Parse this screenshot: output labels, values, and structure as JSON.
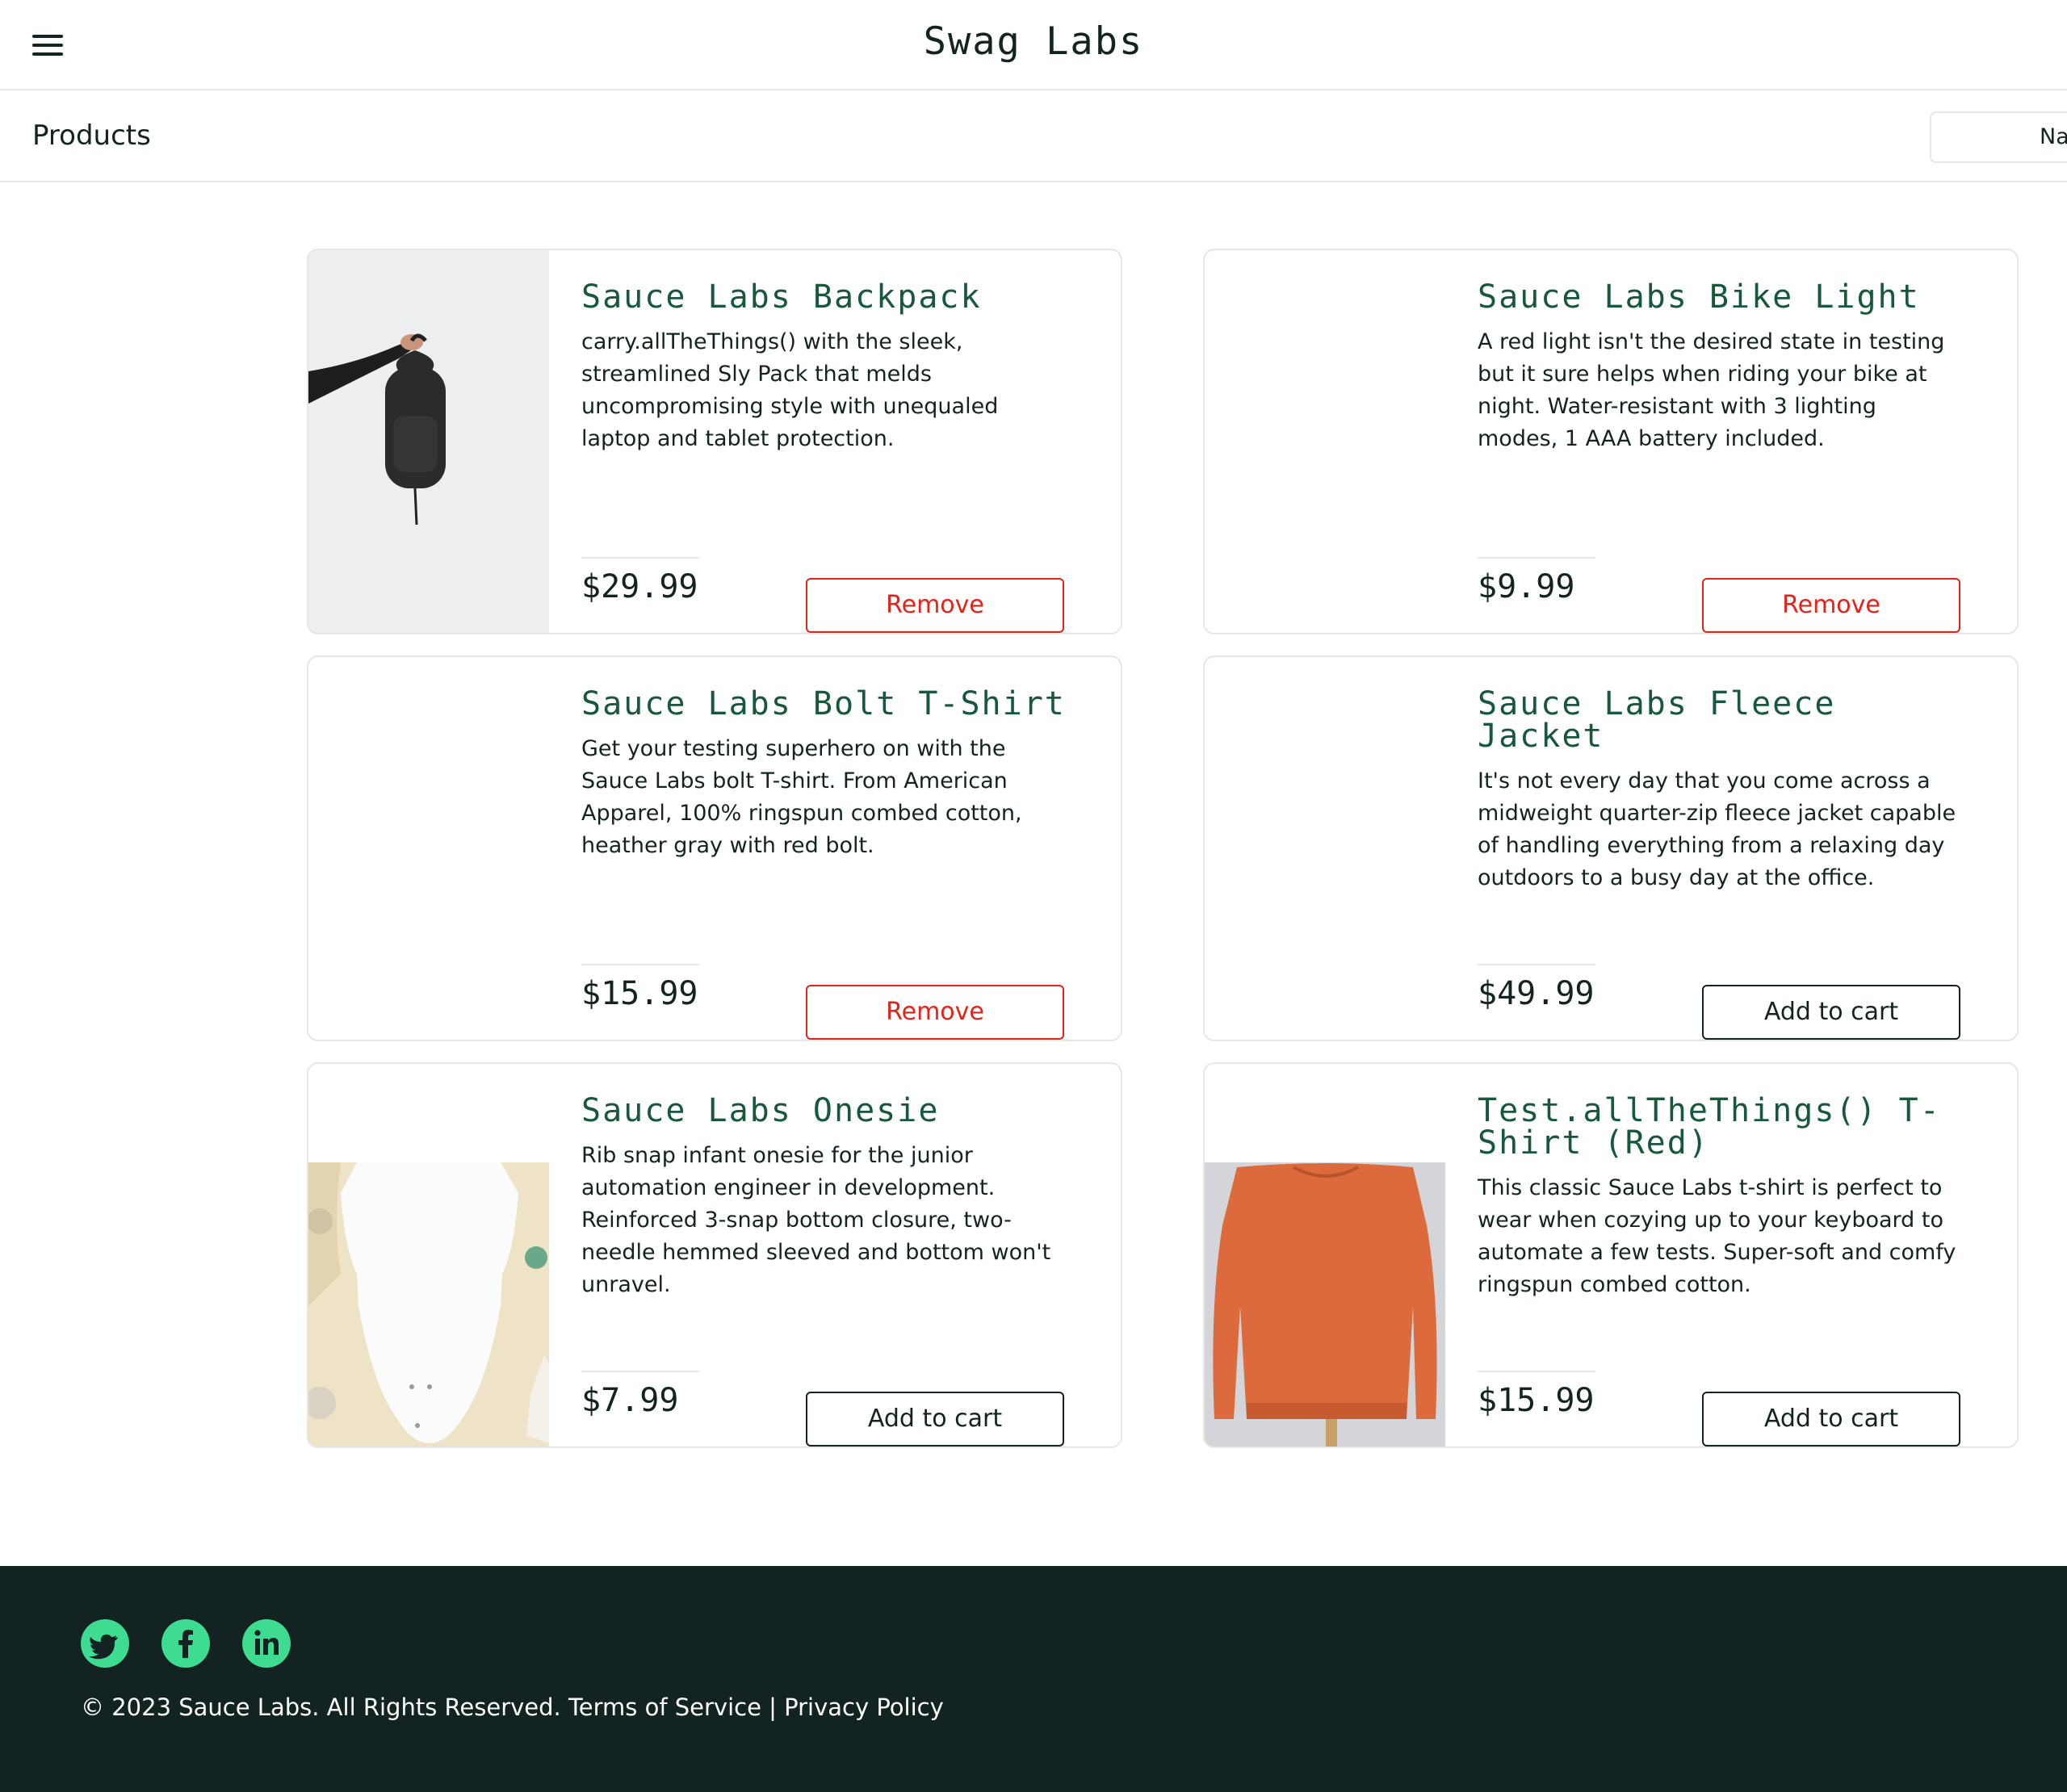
{
  "header": {
    "title": "Swag Labs",
    "menu_icon": "hamburger-menu-icon"
  },
  "subheader": {
    "page_title": "Products",
    "sort_value": "Name (A to Z)"
  },
  "products": [
    {
      "name": "Sauce Labs Backpack",
      "description": "carry.allTheThings() with the sleek, streamlined Sly Pack that melds uncompromising style with unequaled laptop and tablet protection.",
      "price": "$29.99",
      "button": "Remove"
    },
    {
      "name": "Sauce Labs Bike Light",
      "description": "A red light isn't the desired state in testing but it sure helps when riding your bike at night. Water-resistant with 3 lighting modes, 1 AAA battery included.",
      "price": "$9.99",
      "button": "Remove"
    },
    {
      "name": "Sauce Labs Bolt T-Shirt",
      "description": "Get your testing superhero on with the Sauce Labs bolt T-shirt. From American Apparel, 100% ringspun combed cotton, heather gray with red bolt.",
      "price": "$15.99",
      "button": "Remove"
    },
    {
      "name": "Sauce Labs Fleece Jacket",
      "description": "It's not every day that you come across a midweight quarter-zip fleece jacket capable of handling everything from a relaxing day outdoors to a busy day at the office.",
      "price": "$49.99",
      "button": "Add to cart"
    },
    {
      "name": "Sauce Labs Onesie",
      "description": "Rib snap infant onesie for the junior automation engineer in development. Reinforced 3-snap bottom closure, two-needle hemmed sleeved and bottom won't unravel.",
      "price": "$7.99",
      "button": "Add to cart"
    },
    {
      "name": "Test.allTheThings() T-Shirt (Red)",
      "description": "This classic Sauce Labs t-shirt is perfect to wear when cozying up to your keyboard to automate a few tests. Super-soft and comfy ringspun combed cotton.",
      "price": "$15.99",
      "button": "Add to cart"
    }
  ],
  "footer": {
    "social": [
      "twitter-icon",
      "facebook-icon",
      "linkedin-icon"
    ],
    "copyright": "© 2023 Sauce Labs. All Rights Reserved. Terms of Service | Privacy Policy"
  },
  "colors": {
    "accent_green": "#18583a",
    "remove_red": "#e2231a",
    "footer_bg": "#132322",
    "social_green": "#3ddc91"
  }
}
